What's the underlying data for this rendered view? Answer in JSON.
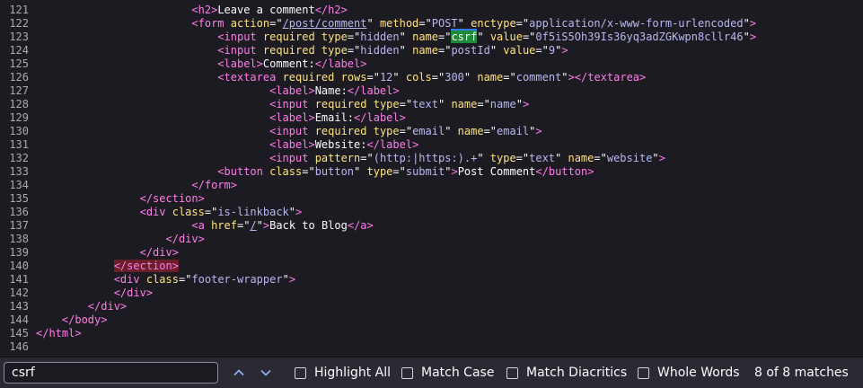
{
  "source_lines": [
    {
      "num": "121",
      "tokens": [
        [
          "text",
          "                        "
        ],
        [
          "tag",
          "<h2"
        ],
        [
          "tag",
          ">"
        ],
        [
          "text",
          "Leave a comment"
        ],
        [
          "tag",
          "</h2"
        ],
        [
          "tag",
          ">"
        ]
      ]
    },
    {
      "num": "122",
      "tokens": [
        [
          "text",
          "                        "
        ],
        [
          "tag",
          "<form"
        ],
        [
          "text",
          " "
        ],
        [
          "attr",
          "action"
        ],
        [
          "text",
          "=\""
        ],
        [
          "link",
          "/post/comment"
        ],
        [
          "text",
          "\" "
        ],
        [
          "attr",
          "method"
        ],
        [
          "text",
          "=\""
        ],
        [
          "val",
          "POST"
        ],
        [
          "text",
          "\" "
        ],
        [
          "attr",
          "enctype"
        ],
        [
          "text",
          "=\""
        ],
        [
          "val",
          "application/x-www-form-urlencoded"
        ],
        [
          "text",
          "\""
        ],
        [
          "tag",
          ">"
        ]
      ]
    },
    {
      "num": "123",
      "tokens": [
        [
          "text",
          "                            "
        ],
        [
          "tag",
          "<input"
        ],
        [
          "text",
          " "
        ],
        [
          "attr",
          "required"
        ],
        [
          "text",
          " "
        ],
        [
          "attr",
          "type"
        ],
        [
          "text",
          "=\""
        ],
        [
          "val",
          "hidden"
        ],
        [
          "text",
          "\" "
        ],
        [
          "attr",
          "name"
        ],
        [
          "text",
          "=\""
        ],
        [
          "cur",
          "csrf"
        ],
        [
          "text",
          "\" "
        ],
        [
          "attr",
          "value"
        ],
        [
          "text",
          "=\""
        ],
        [
          "val",
          "0f5iS5Oh39Is36yq3adZGKwpn8cllr46"
        ],
        [
          "text",
          "\""
        ],
        [
          "tag",
          ">"
        ]
      ]
    },
    {
      "num": "124",
      "tokens": [
        [
          "text",
          "                            "
        ],
        [
          "tag",
          "<input"
        ],
        [
          "text",
          " "
        ],
        [
          "attr",
          "required"
        ],
        [
          "text",
          " "
        ],
        [
          "attr",
          "type"
        ],
        [
          "text",
          "=\""
        ],
        [
          "val",
          "hidden"
        ],
        [
          "text",
          "\" "
        ],
        [
          "attr",
          "name"
        ],
        [
          "text",
          "=\""
        ],
        [
          "val",
          "postId"
        ],
        [
          "text",
          "\" "
        ],
        [
          "attr",
          "value"
        ],
        [
          "text",
          "=\""
        ],
        [
          "val",
          "9"
        ],
        [
          "text",
          "\""
        ],
        [
          "tag",
          ">"
        ]
      ]
    },
    {
      "num": "125",
      "tokens": [
        [
          "text",
          "                            "
        ],
        [
          "tag",
          "<label"
        ],
        [
          "tag",
          ">"
        ],
        [
          "text",
          "Comment:"
        ],
        [
          "tag",
          "</label"
        ],
        [
          "tag",
          ">"
        ]
      ]
    },
    {
      "num": "126",
      "tokens": [
        [
          "text",
          "                            "
        ],
        [
          "tag",
          "<textarea"
        ],
        [
          "text",
          " "
        ],
        [
          "attr",
          "required"
        ],
        [
          "text",
          " "
        ],
        [
          "attr",
          "rows"
        ],
        [
          "text",
          "=\""
        ],
        [
          "val",
          "12"
        ],
        [
          "text",
          "\" "
        ],
        [
          "attr",
          "cols"
        ],
        [
          "text",
          "=\""
        ],
        [
          "val",
          "300"
        ],
        [
          "text",
          "\" "
        ],
        [
          "attr",
          "name"
        ],
        [
          "text",
          "=\""
        ],
        [
          "val",
          "comment"
        ],
        [
          "text",
          "\""
        ],
        [
          "tag",
          ">"
        ],
        [
          "tag",
          "</textarea"
        ],
        [
          "tag",
          ">"
        ]
      ]
    },
    {
      "num": "127",
      "tokens": [
        [
          "text",
          "                                    "
        ],
        [
          "tag",
          "<label"
        ],
        [
          "tag",
          ">"
        ],
        [
          "text",
          "Name:"
        ],
        [
          "tag",
          "</label"
        ],
        [
          "tag",
          ">"
        ]
      ]
    },
    {
      "num": "128",
      "tokens": [
        [
          "text",
          "                                    "
        ],
        [
          "tag",
          "<input"
        ],
        [
          "text",
          " "
        ],
        [
          "attr",
          "required"
        ],
        [
          "text",
          " "
        ],
        [
          "attr",
          "type"
        ],
        [
          "text",
          "=\""
        ],
        [
          "val",
          "text"
        ],
        [
          "text",
          "\" "
        ],
        [
          "attr",
          "name"
        ],
        [
          "text",
          "=\""
        ],
        [
          "val",
          "name"
        ],
        [
          "text",
          "\""
        ],
        [
          "tag",
          ">"
        ]
      ]
    },
    {
      "num": "129",
      "tokens": [
        [
          "text",
          "                                    "
        ],
        [
          "tag",
          "<label"
        ],
        [
          "tag",
          ">"
        ],
        [
          "text",
          "Email:"
        ],
        [
          "tag",
          "</label"
        ],
        [
          "tag",
          ">"
        ]
      ]
    },
    {
      "num": "130",
      "tokens": [
        [
          "text",
          "                                    "
        ],
        [
          "tag",
          "<input"
        ],
        [
          "text",
          " "
        ],
        [
          "attr",
          "required"
        ],
        [
          "text",
          " "
        ],
        [
          "attr",
          "type"
        ],
        [
          "text",
          "=\""
        ],
        [
          "val",
          "email"
        ],
        [
          "text",
          "\" "
        ],
        [
          "attr",
          "name"
        ],
        [
          "text",
          "=\""
        ],
        [
          "val",
          "email"
        ],
        [
          "text",
          "\""
        ],
        [
          "tag",
          ">"
        ]
      ]
    },
    {
      "num": "131",
      "tokens": [
        [
          "text",
          "                                    "
        ],
        [
          "tag",
          "<label"
        ],
        [
          "tag",
          ">"
        ],
        [
          "text",
          "Website:"
        ],
        [
          "tag",
          "</label"
        ],
        [
          "tag",
          ">"
        ]
      ]
    },
    {
      "num": "132",
      "tokens": [
        [
          "text",
          "                                    "
        ],
        [
          "tag",
          "<input"
        ],
        [
          "text",
          " "
        ],
        [
          "attr",
          "pattern"
        ],
        [
          "text",
          "=\""
        ],
        [
          "val",
          "(http:|https:).+"
        ],
        [
          "text",
          "\" "
        ],
        [
          "attr",
          "type"
        ],
        [
          "text",
          "=\""
        ],
        [
          "val",
          "text"
        ],
        [
          "text",
          "\" "
        ],
        [
          "attr",
          "name"
        ],
        [
          "text",
          "=\""
        ],
        [
          "val",
          "website"
        ],
        [
          "text",
          "\""
        ],
        [
          "tag",
          ">"
        ]
      ]
    },
    {
      "num": "133",
      "tokens": [
        [
          "text",
          "                            "
        ],
        [
          "tag",
          "<button"
        ],
        [
          "text",
          " "
        ],
        [
          "attr",
          "class"
        ],
        [
          "text",
          "=\""
        ],
        [
          "val",
          "button"
        ],
        [
          "text",
          "\" "
        ],
        [
          "attr",
          "type"
        ],
        [
          "text",
          "=\""
        ],
        [
          "val",
          "submit"
        ],
        [
          "text",
          "\""
        ],
        [
          "tag",
          ">"
        ],
        [
          "text",
          "Post Comment"
        ],
        [
          "tag",
          "</button"
        ],
        [
          "tag",
          ">"
        ]
      ]
    },
    {
      "num": "134",
      "tokens": [
        [
          "text",
          "                        "
        ],
        [
          "tag",
          "</form"
        ],
        [
          "tag",
          ">"
        ]
      ]
    },
    {
      "num": "135",
      "tokens": [
        [
          "text",
          "                "
        ],
        [
          "tag",
          "</section"
        ],
        [
          "tag",
          ">"
        ]
      ]
    },
    {
      "num": "136",
      "tokens": [
        [
          "text",
          "                "
        ],
        [
          "tag",
          "<div"
        ],
        [
          "text",
          " "
        ],
        [
          "attr",
          "class"
        ],
        [
          "text",
          "=\""
        ],
        [
          "val",
          "is-linkback"
        ],
        [
          "text",
          "\""
        ],
        [
          "tag",
          ">"
        ]
      ]
    },
    {
      "num": "137",
      "tokens": [
        [
          "text",
          "                        "
        ],
        [
          "tag",
          "<a"
        ],
        [
          "text",
          " "
        ],
        [
          "attr",
          "href"
        ],
        [
          "text",
          "=\""
        ],
        [
          "link",
          "/"
        ],
        [
          "text",
          "\""
        ],
        [
          "tag",
          ">"
        ],
        [
          "text",
          "Back to Blog"
        ],
        [
          "tag",
          "</a"
        ],
        [
          "tag",
          ">"
        ]
      ]
    },
    {
      "num": "138",
      "tokens": [
        [
          "text",
          "                    "
        ],
        [
          "tag",
          "</div"
        ],
        [
          "tag",
          ">"
        ]
      ]
    },
    {
      "num": "139",
      "tokens": [
        [
          "text",
          "                "
        ],
        [
          "tag",
          "</div"
        ],
        [
          "tag",
          ">"
        ]
      ]
    },
    {
      "num": "140",
      "tokens": [
        [
          "text",
          "            "
        ],
        [
          "err",
          "</section>"
        ]
      ]
    },
    {
      "num": "141",
      "tokens": [
        [
          "text",
          "            "
        ],
        [
          "tag",
          "<div"
        ],
        [
          "text",
          " "
        ],
        [
          "attr",
          "class"
        ],
        [
          "text",
          "=\""
        ],
        [
          "val",
          "footer-wrapper"
        ],
        [
          "text",
          "\""
        ],
        [
          "tag",
          ">"
        ]
      ]
    },
    {
      "num": "142",
      "tokens": [
        [
          "text",
          "            "
        ],
        [
          "tag",
          "</div"
        ],
        [
          "tag",
          ">"
        ]
      ]
    },
    {
      "num": "143",
      "tokens": [
        [
          "text",
          "        "
        ],
        [
          "tag",
          "</div"
        ],
        [
          "tag",
          ">"
        ]
      ]
    },
    {
      "num": "144",
      "tokens": [
        [
          "text",
          "    "
        ],
        [
          "tag",
          "</body"
        ],
        [
          "tag",
          ">"
        ]
      ]
    },
    {
      "num": "145",
      "tokens": [
        [
          "tag",
          "</html"
        ],
        [
          "tag",
          ">"
        ]
      ]
    },
    {
      "num": "146",
      "tokens": []
    }
  ],
  "findbar": {
    "query": "csrf",
    "prev_icon": "chevron-up-icon",
    "next_icon": "chevron-down-icon",
    "highlight_all_label": "Highlight All",
    "match_case_label": "Match Case",
    "match_diacritics_label": "Match Diacritics",
    "whole_words_label": "Whole Words",
    "match_count": "8 of 8 matches"
  },
  "colors": {
    "background": "#1c1b22",
    "tag": "#ff7de9",
    "attribute": "#ffe37e",
    "value": "#b8b8f0",
    "current_match": "#1f8a3a"
  }
}
